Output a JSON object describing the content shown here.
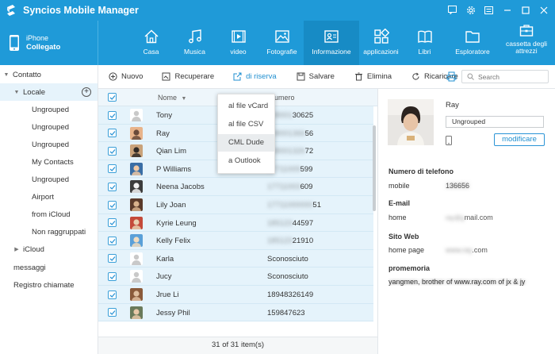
{
  "app": {
    "title": "Syncios Mobile Manager"
  },
  "device": {
    "name": "iPhone",
    "status": "Collegato"
  },
  "nav": {
    "tabs": [
      {
        "label": "Casa",
        "icon": "home-icon"
      },
      {
        "label": "Musica",
        "icon": "music-icon"
      },
      {
        "label": "video",
        "icon": "video-icon"
      },
      {
        "label": "Fotografie",
        "icon": "photo-icon"
      },
      {
        "label": "Informazione",
        "icon": "contact-card-icon"
      },
      {
        "label": "applicazioni",
        "icon": "apps-icon"
      },
      {
        "label": "Libri",
        "icon": "book-icon"
      },
      {
        "label": "Esploratore",
        "icon": "folder-icon"
      },
      {
        "label": "cassetta degli attrezzi",
        "label1": "cassetta degli",
        "label2": "attrezzi",
        "icon": "toolbox-icon"
      }
    ],
    "active_tab": "Informazione"
  },
  "sidebar": {
    "items": [
      {
        "label": "Contatto"
      },
      {
        "label": "Locale"
      },
      {
        "label": "Ungrouped"
      },
      {
        "label": "Ungrouped"
      },
      {
        "label": "Ungrouped"
      },
      {
        "label": "My Contacts"
      },
      {
        "label": "Ungrouped"
      },
      {
        "label": "Airport"
      },
      {
        "label": "from iCloud"
      },
      {
        "label": "Non raggruppati"
      },
      {
        "label": "iCloud"
      },
      {
        "label": "messaggi"
      },
      {
        "label": "Registro chiamate"
      }
    ]
  },
  "toolbar": {
    "new_label": "Nuovo",
    "recover_label": "Recuperare",
    "backup_label": "di riserva",
    "save_label": "Salvare",
    "delete_label": "Elimina",
    "refresh_label": "Ricaricare",
    "search_placeholder": "Search"
  },
  "backup_menu": {
    "items": [
      "al file vCard",
      "al file CSV",
      "CML Dude",
      "a Outlook"
    ],
    "highlighted": "CML Dude"
  },
  "table": {
    "headers": {
      "name": "Nome",
      "number": "umero"
    },
    "rows": [
      {
        "name": "Tony",
        "number": "13800130625",
        "number_visible": "30625"
      },
      {
        "name": "Ray",
        "number": "13800136656",
        "number_visible": "56"
      },
      {
        "name": "Qian Lim",
        "number": "13800132672",
        "number_visible": "72"
      },
      {
        "name": "P Williams",
        "number": "17711009599",
        "number_visible": "599"
      },
      {
        "name": "Neena Jacobs",
        "number": "17711003609",
        "number_visible": "609"
      },
      {
        "name": "Lily Joan",
        "number": "1771100000051",
        "number_visible": "51"
      },
      {
        "name": "Kyrie Leung",
        "number": "18512344497",
        "number_visible": "44597"
      },
      {
        "name": "Kelly Felix",
        "number": "18512321910",
        "number_visible": "21910"
      },
      {
        "name": "Karla",
        "number": "Sconosciuto"
      },
      {
        "name": "Jucy",
        "number": "Sconosciuto"
      },
      {
        "name": "Jrue Li",
        "number": "18948326149"
      },
      {
        "name": "Jessy Phil",
        "number": "159847623"
      }
    ]
  },
  "status": {
    "count_text": "31 of 31 item(s)"
  },
  "detail": {
    "name": "Ray",
    "group": "Ungrouped",
    "edit_label": "modificare",
    "phone_section": "Numero di telefono",
    "phone_key": "mobile",
    "phone_value": "136656",
    "email_section": "E-mail",
    "email_key": "home",
    "email_value": "ray@gmail.com",
    "web_section": "Sito Web",
    "web_key": "home page",
    "web_value": "www.ray.com",
    "memo_section": "promemoria",
    "memo_value": "yangmen, brother of www.ray.com of jx & jy"
  },
  "colors": {
    "brand": "#1f9ad8",
    "row_selected": "#e5f3fb",
    "accent": "#1f8fd0"
  }
}
